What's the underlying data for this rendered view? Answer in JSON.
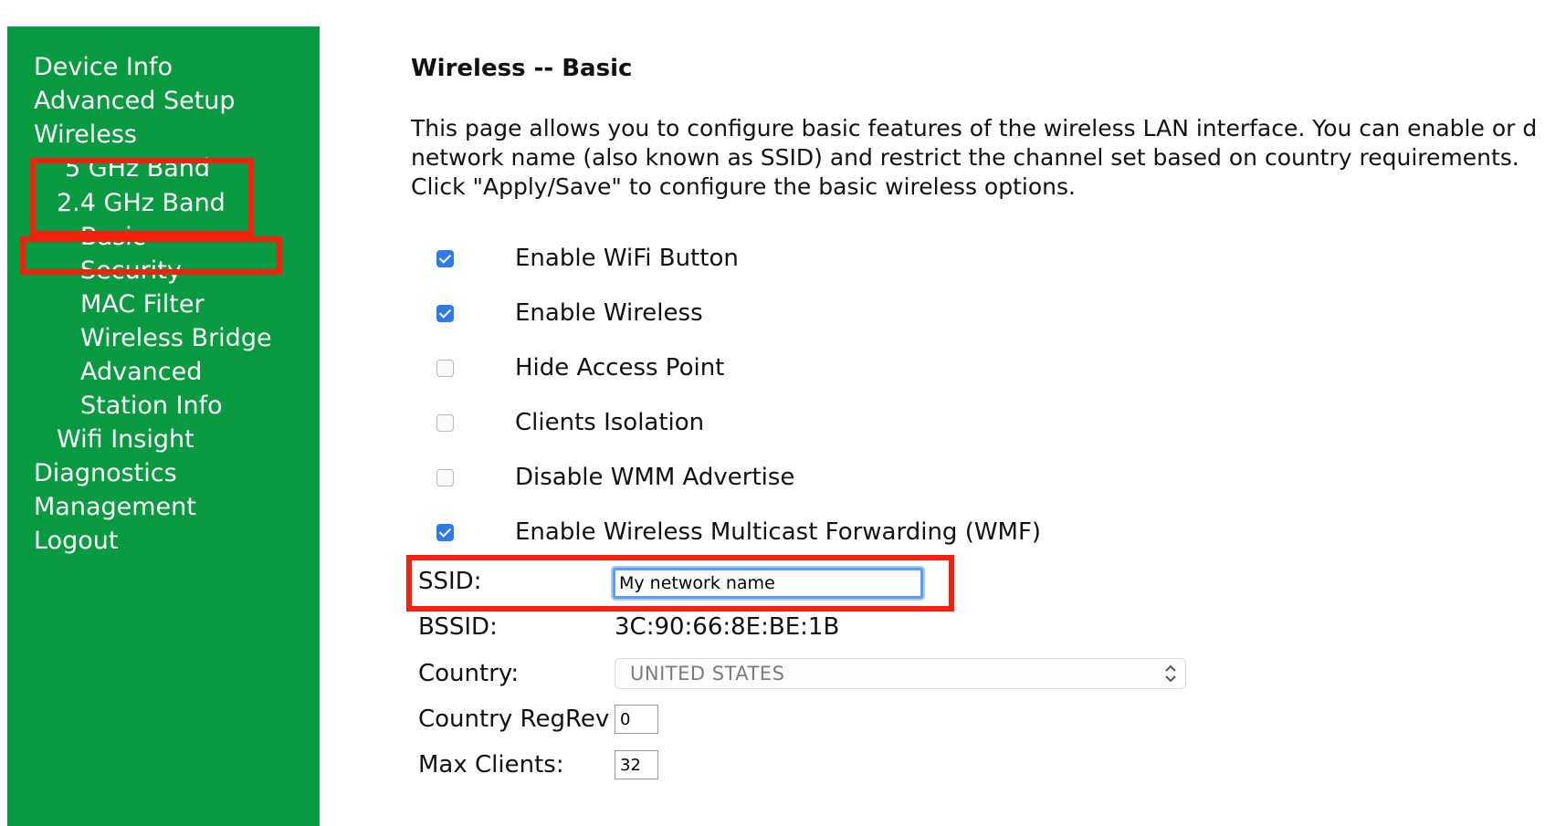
{
  "sidebar": {
    "items": [
      {
        "label": "Device Info"
      },
      {
        "label": "Advanced Setup"
      },
      {
        "label": "Wireless"
      },
      {
        "label": "5 GHz Band"
      },
      {
        "label": "2.4 GHz Band"
      },
      {
        "label": "Basic"
      },
      {
        "label": "Security"
      },
      {
        "label": "MAC Filter"
      },
      {
        "label": "Wireless Bridge"
      },
      {
        "label": "Advanced"
      },
      {
        "label": "Station Info"
      },
      {
        "label": "Wifi Insight"
      },
      {
        "label": "Diagnostics"
      },
      {
        "label": "Management"
      },
      {
        "label": "Logout"
      }
    ],
    "background_color": "#079a41"
  },
  "main": {
    "title": "Wireless -- Basic",
    "description": [
      "This page allows you to configure basic features of the wireless LAN interface. You can enable or d",
      "network name (also known as SSID) and restrict the channel set based on country requirements.",
      "Click \"Apply/Save\" to configure the basic wireless options."
    ],
    "options": [
      {
        "label": "Enable WiFi Button",
        "checked": true
      },
      {
        "label": "Enable Wireless",
        "checked": true
      },
      {
        "label": "Hide Access Point",
        "checked": false
      },
      {
        "label": "Clients Isolation",
        "checked": false
      },
      {
        "label": "Disable WMM Advertise",
        "checked": false
      },
      {
        "label": "Enable Wireless Multicast Forwarding (WMF)",
        "checked": true
      }
    ],
    "fields": {
      "ssid_label": "SSID:",
      "ssid_value": "My network name",
      "bssid_label": "BSSID:",
      "bssid_value": "3C:90:66:8E:BE:1B",
      "country_label": "Country:",
      "country_value": "UNITED STATES",
      "regrev_label": "Country RegRev",
      "regrev_value": "0",
      "max_clients_label": "Max Clients:",
      "max_clients_value": "32"
    }
  },
  "highlight_color": "#f5210c",
  "checkbox_checked_color": "#2f7ae5"
}
